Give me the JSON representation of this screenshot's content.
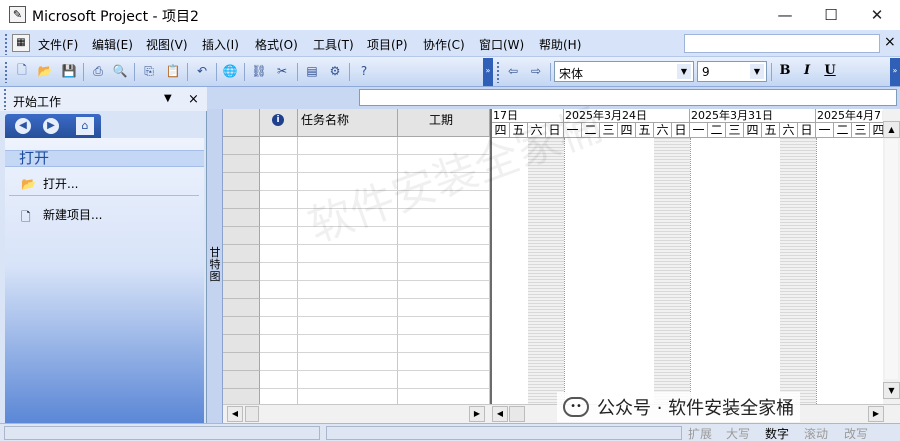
{
  "window": {
    "title": "Microsoft Project - 项目2",
    "app_icon": "project-doc-icon",
    "minimize_glyph": "—",
    "maximize_glyph": "☐",
    "close_glyph": "✕"
  },
  "menubar": {
    "items": [
      "文件(F)",
      "编辑(E)",
      "视图(V)",
      "插入(I)",
      "格式(O)",
      "工具(T)",
      "项目(P)",
      "协作(C)",
      "窗口(W)",
      "帮助(H)"
    ],
    "close_glyph": "×"
  },
  "toolbar": {
    "font": "宋体",
    "size": "9",
    "bold": "B",
    "italic": "I",
    "underline": "U",
    "icons": [
      "new-icon",
      "open-icon",
      "save-icon",
      "print-icon",
      "print-preview-icon",
      "copy-icon",
      "paste-icon",
      "undo-icon",
      "hyperlink-icon",
      "link-tasks-icon",
      "unlink-tasks-icon",
      "task-info-icon",
      "split-icon",
      "help-icon",
      "arrow-left-icon",
      "arrow-right-icon"
    ]
  },
  "taskpane": {
    "title": "开始工作",
    "section_title": "打开",
    "links": [
      "打开...",
      "新建项目..."
    ]
  },
  "viewbar": {
    "label": "甘特图"
  },
  "grid": {
    "columns": [
      "",
      "任务名称",
      "工期"
    ],
    "info_glyph": "i",
    "row_count": 15
  },
  "gantt": {
    "weeks": [
      "17日",
      "2025年3月24日",
      "2025年3月31日",
      "2025年4月7日"
    ],
    "days": [
      "四",
      "五",
      "六",
      "日",
      "一",
      "二",
      "三",
      "四",
      "五",
      "六",
      "日",
      "一",
      "二",
      "三",
      "四",
      "五",
      "六",
      "日",
      "一",
      "二",
      "三",
      "四"
    ]
  },
  "statusbar": {
    "indicators": [
      {
        "label": "扩展",
        "on": false
      },
      {
        "label": "大写",
        "on": false
      },
      {
        "label": "数字",
        "on": true
      },
      {
        "label": "滚动",
        "on": false
      },
      {
        "label": "改写",
        "on": false
      }
    ]
  },
  "watermark": {
    "text": "公众号 · 软件安装全家桶",
    "background_text": "软件安装全家桶"
  }
}
